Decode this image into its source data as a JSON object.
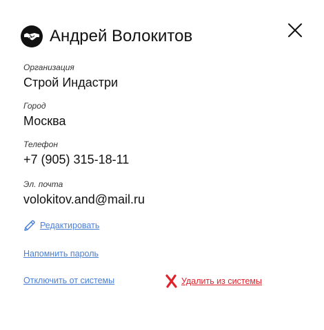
{
  "user": {
    "name": "Андрей Волокитов",
    "avatar_icon": "handshake-icon"
  },
  "fields": [
    {
      "label": "Организация",
      "value": "Строй Индастри"
    },
    {
      "label": "Город",
      "value": "Москва"
    },
    {
      "label": "Телефон",
      "value": "+7 (905) 315-18-11"
    },
    {
      "label": "Эл. почта",
      "value": "volokitov.and@mail.ru"
    }
  ],
  "actions": {
    "edit": {
      "label": "Редактировать",
      "icon": "pencil-icon"
    },
    "remind_password": {
      "label": "Напомнить пароль"
    },
    "disconnect": {
      "label": "Отключить от системы"
    },
    "delete": {
      "label": "Удалить из системы",
      "icon": "red-x-icon"
    }
  },
  "colors": {
    "link": "#4a7fd6",
    "danger": "#e0202a",
    "text": "#111111"
  }
}
